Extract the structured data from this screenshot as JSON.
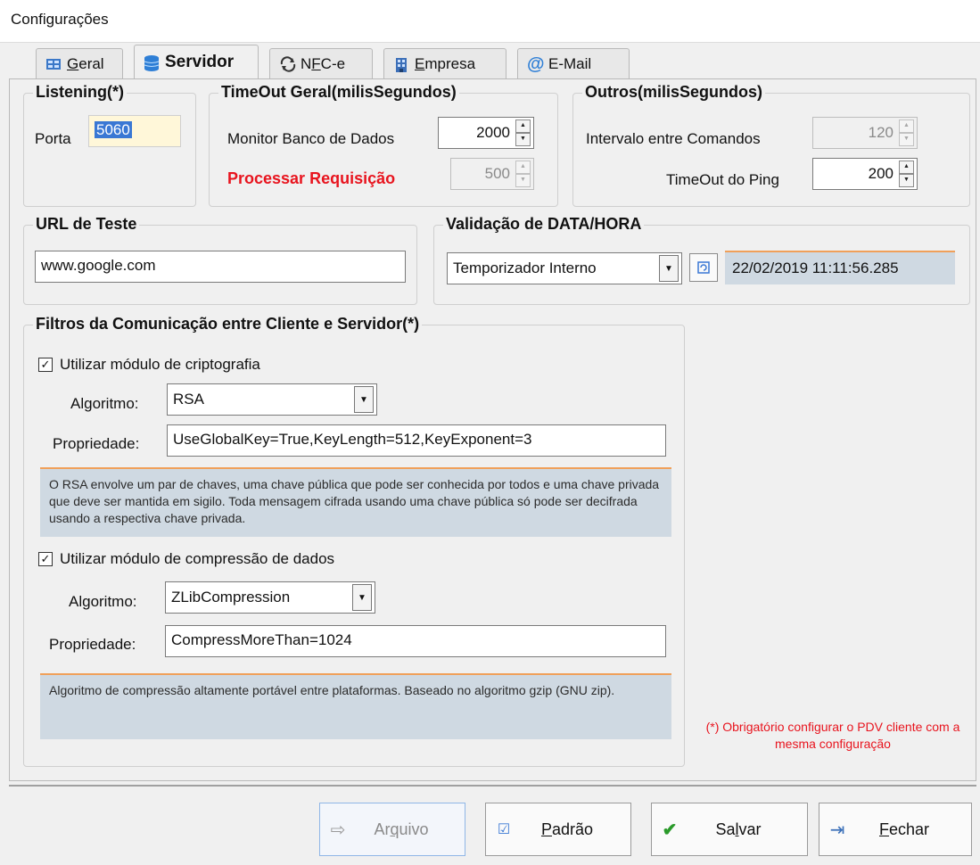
{
  "window": {
    "title": "Configurações"
  },
  "tabs": [
    {
      "label": "Geral",
      "underline": "G",
      "rest": "eral"
    },
    {
      "label": "Servidor"
    },
    {
      "label": "NFC-e",
      "prefix": "N",
      "underline": "F",
      "rest": "C-e"
    },
    {
      "label": "Empresa",
      "underline": "E",
      "rest": "mpresa"
    },
    {
      "label": "E-Mail"
    }
  ],
  "listening": {
    "title": "Listening(*)",
    "porta_label": "Porta",
    "porta_value": "5060"
  },
  "timeout": {
    "title": "TimeOut Geral(milisSegundos)",
    "monitor_label": "Monitor Banco de Dados",
    "monitor_value": "2000",
    "processar_label": "Processar Requisição",
    "processar_value": "500"
  },
  "outros": {
    "title": "Outros(milisSegundos)",
    "intervalo_label": "Intervalo entre Comandos",
    "intervalo_value": "120",
    "ping_label": "TimeOut do Ping",
    "ping_value": "200"
  },
  "url": {
    "title": "URL de Teste",
    "value": "www.google.com"
  },
  "validacao": {
    "title": "Validação de DATA/HORA",
    "mode": "Temporizador Interno",
    "datetime": "22/02/2019 11:11:56.285"
  },
  "filtros": {
    "title": "Filtros da Comunicação entre Cliente e Servidor(*)",
    "cripto": {
      "check_label": "Utilizar módulo de criptografia",
      "algoritmo_label": "Algoritmo:",
      "algoritmo_value": "RSA",
      "propriedade_label": "Propriedade:",
      "propriedade_value": "UseGlobalKey=True,KeyLength=512,KeyExponent=3",
      "note": "O RSA envolve um par de chaves, uma chave pública que pode ser conhecida por todos e uma chave privada que deve ser mantida em sigilo. Toda mensagem cifrada usando uma chave pública só pode ser decifrada usando a respectiva chave privada."
    },
    "compressao": {
      "check_label": "Utilizar módulo de compressão de dados",
      "algoritmo_label": "Algoritmo:",
      "algoritmo_value": "ZLibCompression",
      "propriedade_label": "Propriedade:",
      "propriedade_value": "CompressMoreThan=1024",
      "note": "Algoritmo de compressão altamente portável entre plataformas. Baseado no algoritmo gzip (GNU zip)."
    }
  },
  "obrigatorio_note": "(*) Obrigatório configurar o PDV cliente com a mesma configuração",
  "buttons": {
    "arquivo": {
      "pre": "Ar",
      "u": "q",
      "post": "uivo"
    },
    "padrao": {
      "pre": "",
      "u": "P",
      "post": "adrão"
    },
    "salvar": {
      "pre": "Sa",
      "u": "l",
      "post": "var"
    },
    "fechar": {
      "pre": "",
      "u": "F",
      "post": "echar"
    }
  },
  "colors": {
    "required": "#e8141e",
    "note_bg": "#cfd9e2",
    "note_border": "#f0a05a"
  }
}
